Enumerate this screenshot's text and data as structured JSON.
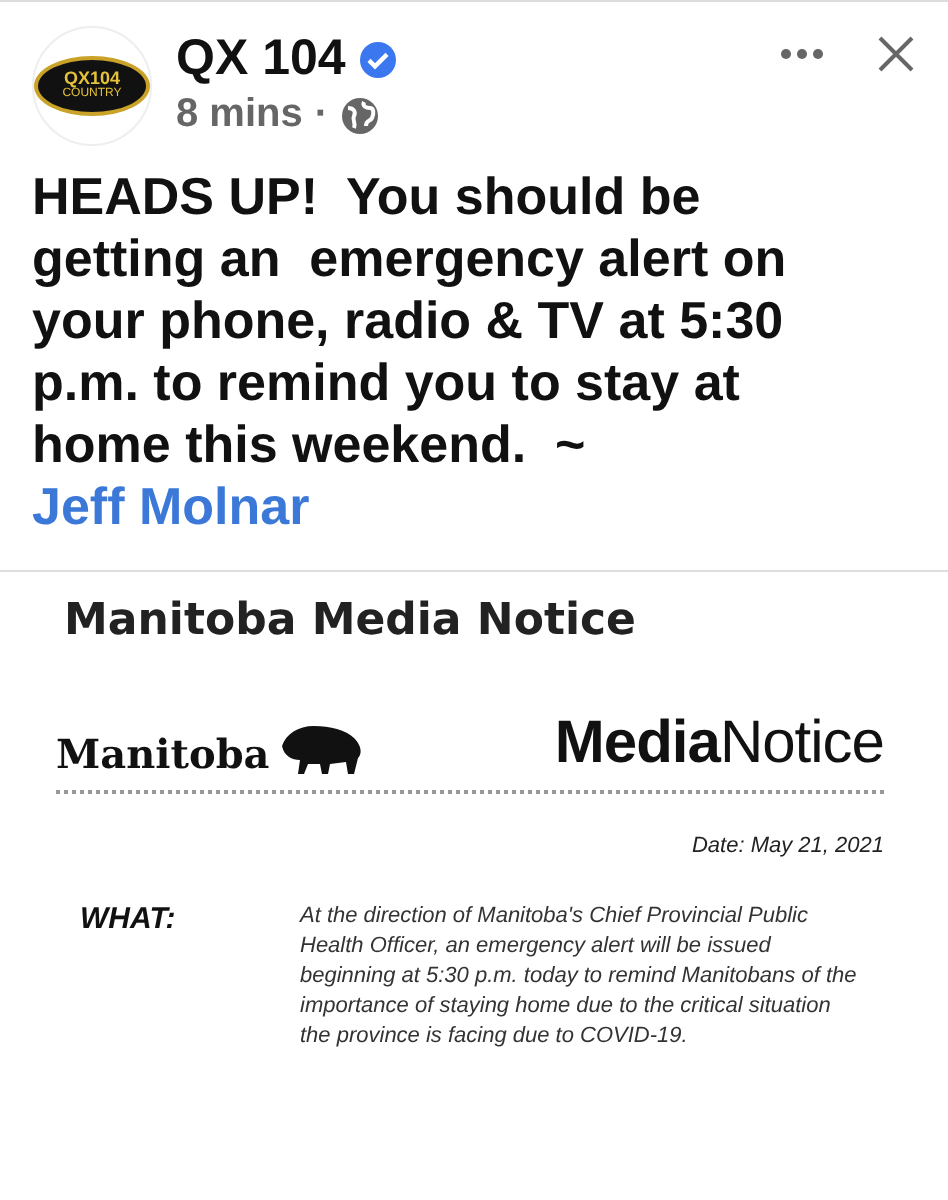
{
  "post": {
    "logo": {
      "title": "QX104",
      "subtitle": "COUNTRY"
    },
    "page_name": "QX 104",
    "verified": true,
    "time": "8 mins",
    "separator": "·",
    "public": true,
    "text": "HEADS UP!  You should be getting an  emergency alert on your phone, radio & TV at 5:30 p.m. to remind you to stay at home this weekend.  ~ ",
    "mention": "Jeff Molnar"
  },
  "attachment": {
    "title": "Manitoba Media Notice",
    "brand": "Manitoba",
    "header": "**Media**Notice",
    "date": "Date: May 21, 2021",
    "sections": [
      {
        "label": "WHAT:",
        "body": "At the direction of Manitoba's Chief Provincial Public Health Officer, an emergency alert will be issued beginning at 5:30 p.m. today to remind Manitobans of the importance of staying home due to the critical situation the province is facing due to COVID-19."
      }
    ]
  }
}
